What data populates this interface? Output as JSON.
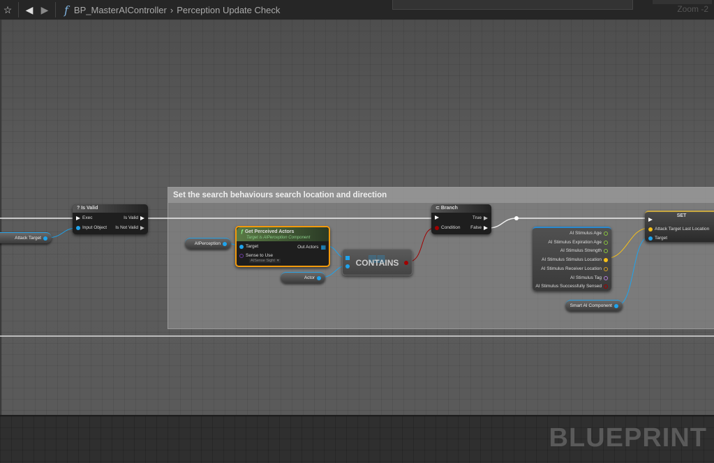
{
  "toolbar": {
    "breadcrumb_root": "BP_MasterAIController",
    "breadcrumb_current": "Perception Update Check",
    "zoom": "Zoom -2"
  },
  "comment": {
    "title": "Set the search behaviours search location and direction"
  },
  "nodes": {
    "attack_target": "Attack Target",
    "is_valid": {
      "title": "Is Valid",
      "exec": "Exec",
      "input": "Input Object",
      "is_valid": "Is Valid",
      "is_not_valid": "Is Not Valid"
    },
    "ai_perception": "AIPerception",
    "get_perceived": {
      "title": "Get Perceived Actors",
      "subtitle": "Target is AIPerception Component",
      "target": "Target",
      "out": "Out Actors",
      "sense": "Sense to Use",
      "sense_value": "AISense Sight"
    },
    "actor": "Actor",
    "contains": "CONTAINS",
    "branch": {
      "title": "Branch",
      "condition": "Condition",
      "true": "True",
      "false": "False"
    },
    "break_struct": [
      "AI Stimulus Age",
      "AI Stimulus Expiration Age",
      "AI Stimulus Strength",
      "AI Stimulus Stimulus Location",
      "AI Stimulus Receiver Location",
      "AI Stimulus Tag",
      "AI Stimulus Successfully Sensed"
    ],
    "smart_ai": "Smart AI Component",
    "set": {
      "title": "SET",
      "attack_loc": "Attack Target Last Location",
      "target": "Target"
    }
  },
  "watermark": "BLUEPRINT",
  "colors": {
    "object": "#1fa3ec",
    "bool": "#a10000",
    "float": "#8ac53e",
    "vector": "#f6c01a",
    "name": "#b57edc",
    "orange_border": "#f29a0c"
  }
}
